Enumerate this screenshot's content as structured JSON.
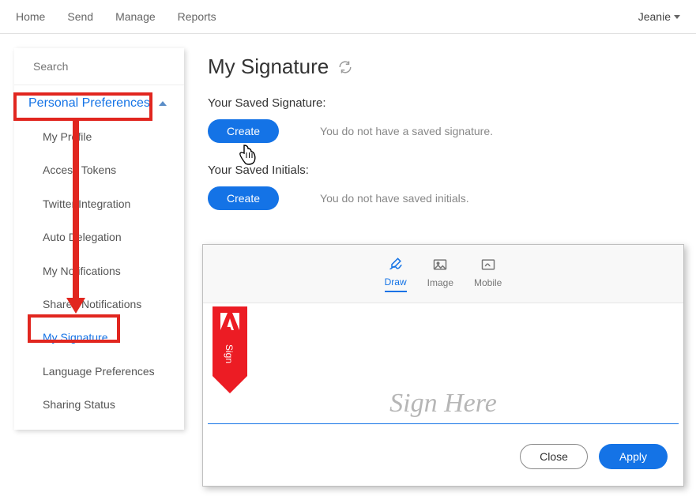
{
  "topnav": {
    "items": [
      "Home",
      "Send",
      "Manage",
      "Reports"
    ],
    "user": "Jeanie"
  },
  "search": {
    "placeholder": "Search"
  },
  "sidebar": {
    "section_label": "Personal Preferences",
    "items": [
      "My Profile",
      "Access Tokens",
      "Twitter Integration",
      "Auto Delegation",
      "My Notifications",
      "Shared Notifications",
      "My Signature",
      "Language Preferences",
      "Sharing Status"
    ]
  },
  "main": {
    "title": "My Signature",
    "sig_heading": "Your Saved Signature:",
    "sig_create": "Create",
    "sig_empty": "You do not have a saved signature.",
    "init_heading": "Your Saved Initials:",
    "init_create": "Create",
    "init_empty": "You do not have saved initials."
  },
  "sigpanel": {
    "tabs": {
      "draw": "Draw",
      "image": "Image",
      "mobile": "Mobile"
    },
    "badge_text": "Sign",
    "placeholder": "Sign Here",
    "close": "Close",
    "apply": "Apply"
  }
}
